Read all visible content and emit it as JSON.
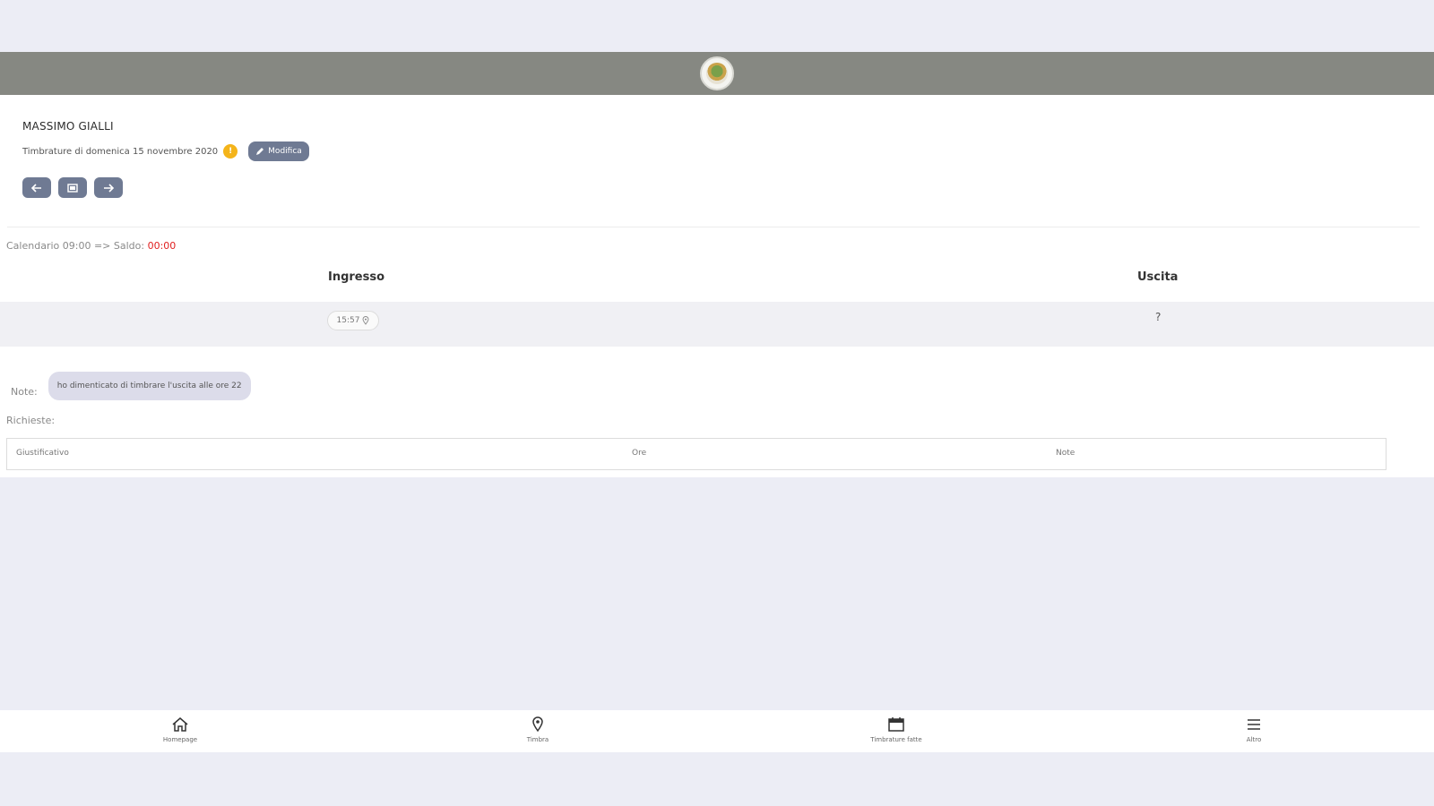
{
  "user": {
    "name": "MASSIMO GIALLI",
    "date_line": "Timbrature di domenica 15 novembre 2020",
    "info_badge": "!",
    "edit_label": "Modifica"
  },
  "calendar": {
    "prefix": "Calendario 09:00 => Saldo:",
    "balance": "00:00"
  },
  "columns": {
    "in": "Ingresso",
    "out": "Uscita"
  },
  "punch": {
    "in_time": "15:57",
    "out_time": "?"
  },
  "note": {
    "label": "Note:",
    "text": "ho dimenticato di timbrare l'uscita alle ore 22"
  },
  "request": {
    "label": "Richieste:",
    "headers": [
      "Giustificativo",
      "Ore",
      "Note"
    ]
  },
  "bottom_nav": [
    {
      "label": "Homepage",
      "icon": "home-icon"
    },
    {
      "label": "Timbra",
      "icon": "location-pin-icon"
    },
    {
      "label": "Timbrature fatte",
      "icon": "calendar-icon"
    },
    {
      "label": "Altro",
      "icon": "menu-icon"
    }
  ],
  "colors": {
    "header": "#868882",
    "button": "#6f7a93",
    "accent_warning": "#f4b41a",
    "balance_red": "#e02020"
  }
}
